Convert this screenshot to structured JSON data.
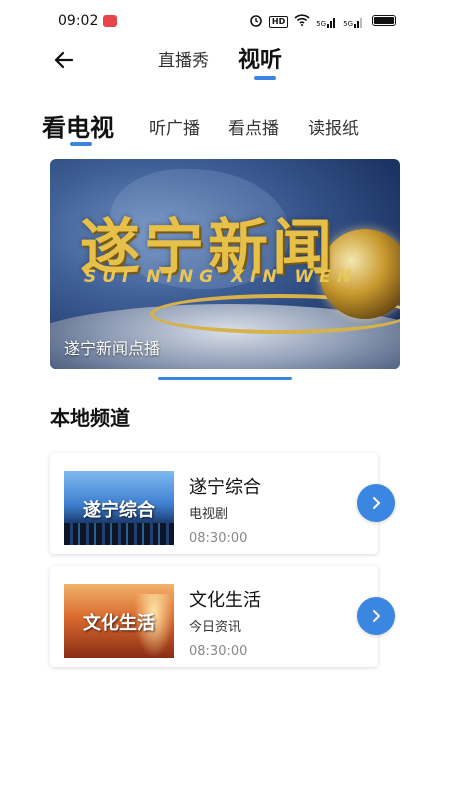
{
  "status_bar": {
    "time": "09:02",
    "hd_label": "HD",
    "signal1_label": "5G",
    "signal2_label": "5G"
  },
  "header": {
    "tabs": [
      {
        "label": "直播秀"
      },
      {
        "label": "视听"
      }
    ],
    "active_tab": "视听"
  },
  "categories": [
    {
      "label": "看电视"
    },
    {
      "label": "听广播"
    },
    {
      "label": "看点播"
    },
    {
      "label": "读报纸"
    }
  ],
  "banner": {
    "title": "遂宁新闻",
    "subtitle": "SUI NING XIN WEN",
    "caption": "遂宁新闻点播"
  },
  "section": {
    "title": "本地频道"
  },
  "channels": [
    {
      "thumb_text": "遂宁综合",
      "name": "遂宁综合",
      "program": "电视剧",
      "time": "08:30:00"
    },
    {
      "thumb_text": "文化生活",
      "name": "文化生活",
      "program": "今日资讯",
      "time": "08:30:00"
    }
  ],
  "colors": {
    "accent": "#3a86e0",
    "banner_gold": "#e7c04a"
  },
  "icons": {
    "back": "arrow-left-icon",
    "play": "chevron-right-icon"
  }
}
